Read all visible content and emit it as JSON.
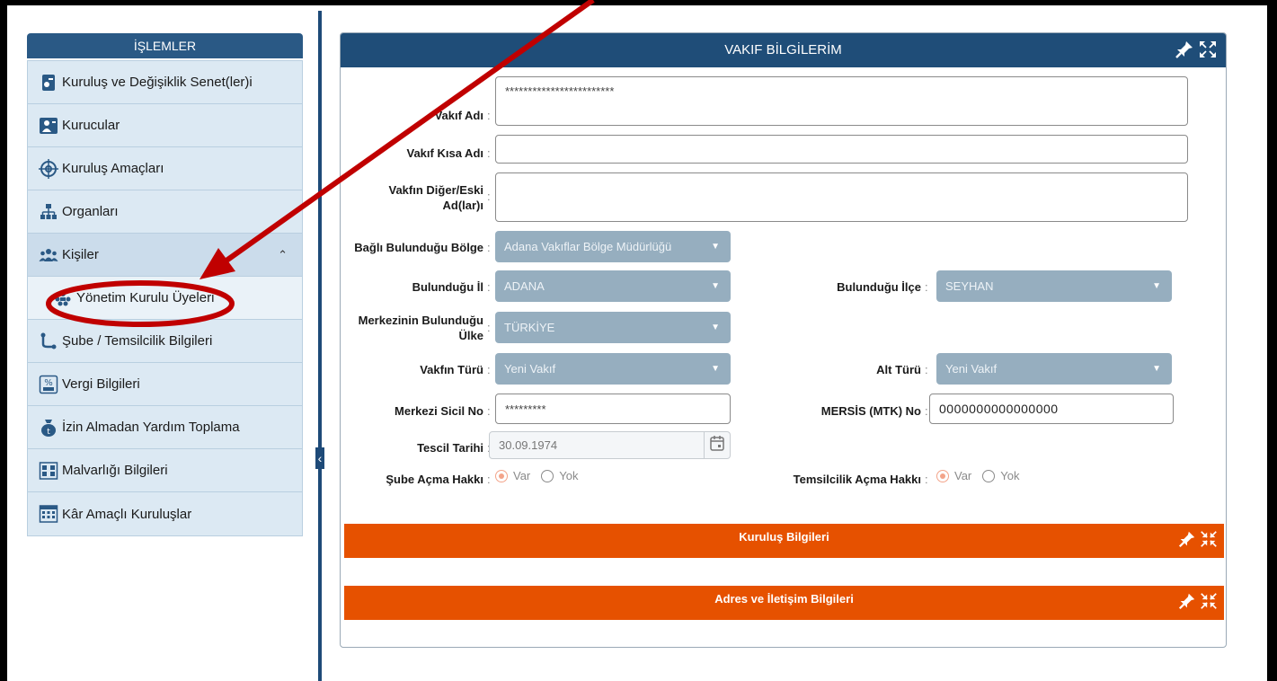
{
  "sidebar": {
    "header": "İŞLEMLER",
    "items": [
      {
        "label": "Kuruluş ve Değişiklik Senet(ler)i",
        "icon": "document-icon"
      },
      {
        "label": "Kurucular",
        "icon": "person-icon"
      },
      {
        "label": "Kuruluş Amaçları",
        "icon": "target-icon"
      },
      {
        "label": "Organları",
        "icon": "org-chart-icon"
      },
      {
        "label": "Kişiler",
        "icon": "people-icon",
        "expanded": true
      },
      {
        "label": "Yönetim Kurulu Üyeleri",
        "icon": "board-members-icon",
        "sub": true
      },
      {
        "label": "Şube / Temsilcilik Bilgileri",
        "icon": "branch-icon"
      },
      {
        "label": "Vergi Bilgileri",
        "icon": "tax-icon"
      },
      {
        "label": "İzin Almadan Yardım Toplama",
        "icon": "donation-icon"
      },
      {
        "label": "Malvarlığı Bilgileri",
        "icon": "assets-icon"
      },
      {
        "label": "Kâr Amaçlı Kuruluşlar",
        "icon": "building-icon"
      }
    ]
  },
  "panel": {
    "title": "VAKIF BİLGİLERİM",
    "labels": {
      "vakif_adi": "Vakıf Adı",
      "vakif_kisa_adi": "Vakıf Kısa Adı",
      "diger_eski_line1": "Vakfın Diğer/Eski",
      "diger_eski_line2": "Ad(lar)ı",
      "bagli_bolge": "Bağlı Bulunduğu Bölge",
      "bulundugu_il": "Bulunduğu İl",
      "bulundugu_ilce": "Bulunduğu İlçe",
      "merkez_ulke_line1": "Merkezinin Bulunduğu",
      "merkez_ulke_line2": "Ülke",
      "vakfin_turu": "Vakfın Türü",
      "alt_turu": "Alt Türü",
      "merkezi_sicil_no": "Merkezi Sicil No",
      "mersis_no": "MERSİS (MTK) No",
      "tescil_tarihi": "Tescil Tarihi",
      "sube_acma": "Şube Açma Hakkı",
      "temsilcilik_acma": "Temsilcilik Açma Hakkı",
      "colon": ":"
    },
    "values": {
      "vakif_adi": "************************",
      "vakif_kisa_adi": "",
      "diger_eski": "",
      "bagli_bolge": "Adana Vakıflar Bölge Müdürlüğü",
      "bulundugu_il": "ADANA",
      "bulundugu_ilce": "SEYHAN",
      "merkez_ulke": "TÜRKİYE",
      "vakfin_turu": "Yeni Vakıf",
      "alt_turu": "Yeni Vakıf",
      "merkezi_sicil_no": "*********",
      "mersis_no": "0000000000000000",
      "tescil_tarihi": "30.09.1974"
    },
    "radio": {
      "var": "Var",
      "yok": "Yok"
    },
    "sections": [
      "Kuruluş Bilgileri",
      "Adres ve İletişim Bilgileri"
    ]
  },
  "colors": {
    "header_blue": "#1f4d78",
    "sidebar_bg": "#dce9f3",
    "section_orange": "#e65100",
    "select_bg": "#96aebf",
    "annotation_red": "#c00000"
  }
}
